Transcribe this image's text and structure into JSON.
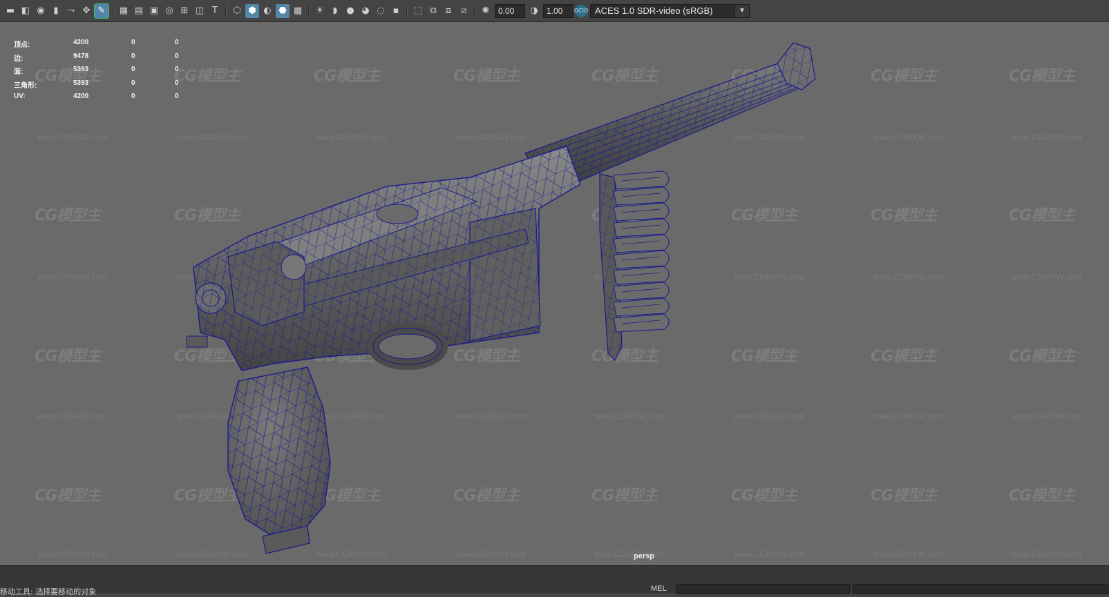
{
  "toolbar": {
    "icons": [
      "camera-icon",
      "camera-attrs-icon",
      "bookmark-icon",
      "image-plane-icon",
      "2d-pan-icon",
      "grease-pencil-icon",
      "grid-icon",
      "film-gate-icon",
      "resolution-gate-icon",
      "gate-mask-icon",
      "field-chart-icon",
      "safe-action-icon",
      "safe-title-icon",
      "wireframe-icon",
      "smooth-shade-icon",
      "default-material-icon",
      "wireframe-on-shaded-icon",
      "xray-icon",
      "lights-icon",
      "shadows-icon",
      "ambient-occlusion-icon",
      "motion-blur-icon",
      "antialias-icon",
      "depth-of-field-icon",
      "isolate-select-icon",
      "xray-joints-icon",
      "xray-active-icon",
      "backface-icon",
      "exposure-icon",
      "gamma-icon",
      "color-management-icon"
    ],
    "exposure_value": "0.00",
    "gamma_value": "1.00",
    "color_space": "ACES 1.0 SDR-video (sRGB)",
    "badge": "OCIO"
  },
  "hud": {
    "rows": [
      {
        "label": "顶点:",
        "c1": "4200",
        "c2": "0",
        "c3": "0"
      },
      {
        "label": "边:",
        "c1": "9478",
        "c2": "0",
        "c3": "0"
      },
      {
        "label": "面:",
        "c1": "5393",
        "c2": "0",
        "c3": "0"
      },
      {
        "label": "三角形:",
        "c1": "5393",
        "c2": "0",
        "c3": "0"
      },
      {
        "label": "UV:",
        "c1": "4200",
        "c2": "0",
        "c3": "0"
      }
    ]
  },
  "watermark": {
    "logo": "CG模型主",
    "url": "www.CGMXW.com"
  },
  "viewport": {
    "camera": "persp"
  },
  "colors": {
    "wire": "#1a1a8c",
    "mesh": "#6e6e6e",
    "viewport_bg": "#6a6a6a"
  },
  "statusbar": {
    "help": "移动工具: 选择要移动的对象",
    "mel_label": "MEL"
  }
}
